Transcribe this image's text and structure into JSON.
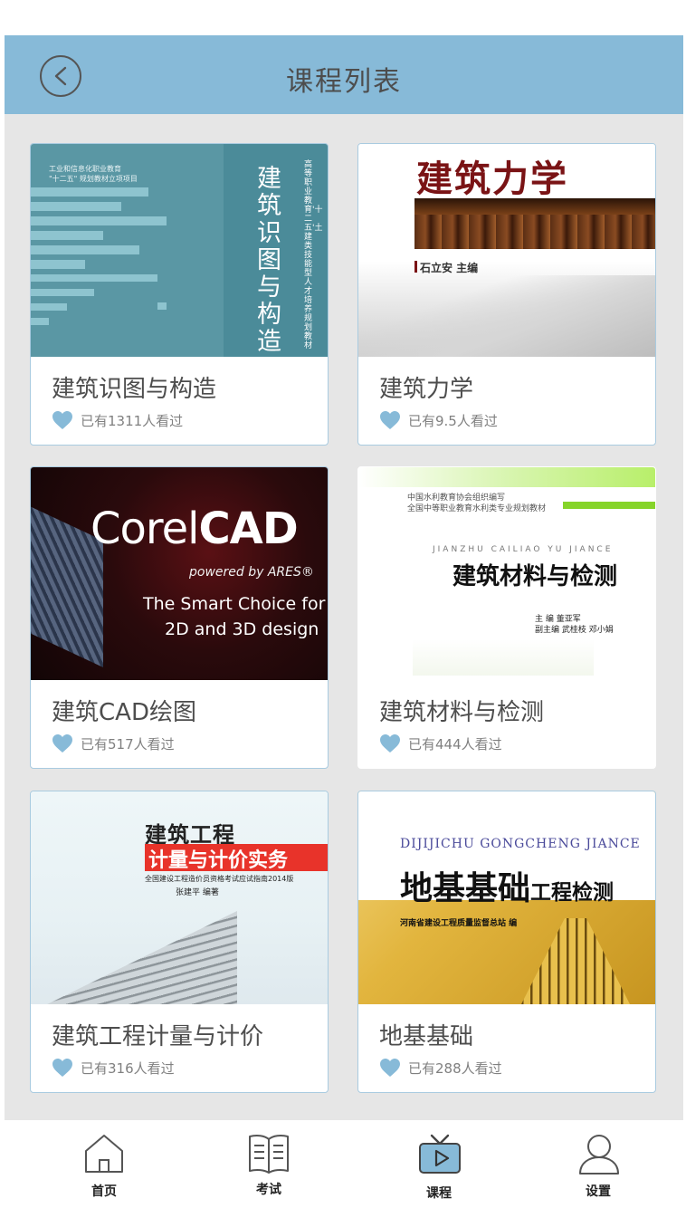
{
  "header": {
    "title": "课程列表"
  },
  "courses": [
    {
      "title": "建筑识图与构造",
      "views": "已有1311人看过",
      "cover": {
        "publisher_line1": "工业和信息化职业教育",
        "publisher_line2": "\"十二五\" 规划教材立项项目",
        "title_vertical": "建筑识图与构造",
        "series_vertical": "高等职业教育'十二五'土建类技能型人才培养规划教材"
      }
    },
    {
      "title": "建筑力学",
      "views": "已有9.5人看过",
      "cover": {
        "title": "建筑力学",
        "author": "石立安  主编"
      }
    },
    {
      "title": "建筑CAD绘图",
      "views": "已有517人看过",
      "cover": {
        "logo_light": "Corel",
        "logo_bold": "CAD",
        "powered": "powered by ARES®",
        "line1": "The Smart Choice for",
        "line2": "2D and 3D design"
      }
    },
    {
      "title": "建筑材料与检测",
      "views": "已有444人看过",
      "cover": {
        "line1": "中国水利教育协会组织编写",
        "line2": "全国中等职业教育水利类专业规划教材",
        "pinyin": "JIANZHU CAILIAO YU JIANCE",
        "title": "建筑材料与检测",
        "editor1": "主  编  董亚军",
        "editor2": "副主编  武桂枝  邓小娟"
      }
    },
    {
      "title": "建筑工程计量与计价",
      "views": "已有316人看过",
      "cover": {
        "title1": "建筑工程",
        "title2": "计量与计价实务",
        "subtitle": "全国建设工程造价员资格考试应试指南2014版",
        "author": "张建平  编著"
      }
    },
    {
      "title": "地基基础",
      "views": "已有288人看过",
      "cover": {
        "pinyin": "DIJIJICHU GONGCHENG JIANCE",
        "title_big": "地基基础",
        "title_small": "工程检测",
        "publisher": "河南省建设工程质量监督总站  编"
      }
    }
  ],
  "tabs": [
    {
      "label": "首页",
      "icon": "home-icon"
    },
    {
      "label": "考试",
      "icon": "book-icon"
    },
    {
      "label": "课程",
      "icon": "tv-icon",
      "active": true
    },
    {
      "label": "设置",
      "icon": "user-icon"
    }
  ],
  "colors": {
    "header_bg": "#87bad8",
    "page_bg": "#e6e6e6",
    "title_text": "#4d4d4d",
    "meta_text": "#808080",
    "heart": "#87bad8"
  }
}
